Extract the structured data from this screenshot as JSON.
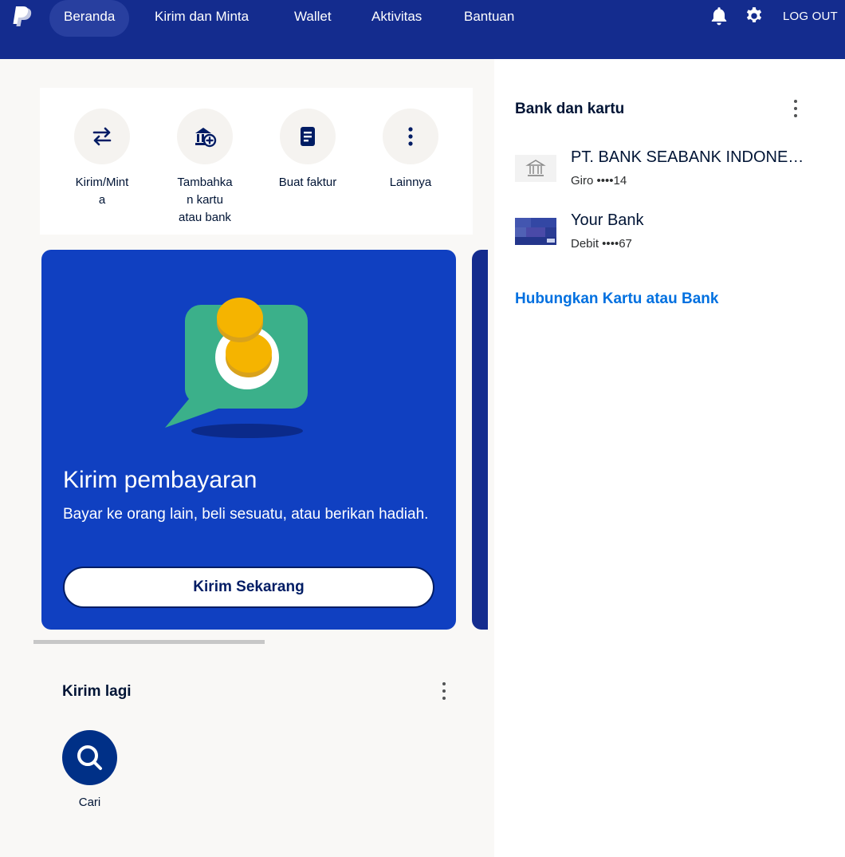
{
  "nav": {
    "logo_icon": "paypal-logo",
    "items": [
      {
        "label": "Beranda",
        "active": true
      },
      {
        "label": "Kirim dan Minta",
        "active": false
      },
      {
        "label": "Wallet",
        "active": false
      },
      {
        "label": "Aktivitas",
        "active": false
      },
      {
        "label": "Bantuan",
        "active": false
      }
    ],
    "icons": [
      "bell-icon",
      "gear-icon"
    ],
    "logout_label": "LOG OUT"
  },
  "quick_actions": [
    {
      "label": "Kirim/Mint\na",
      "icon": "transfer-arrows-icon"
    },
    {
      "label": "Tambahka\nn kartu\natau bank",
      "icon": "add-bank-icon"
    },
    {
      "label": "Buat faktur",
      "icon": "invoice-icon"
    },
    {
      "label": "Lainnya",
      "icon": "more-vertical-icon"
    }
  ],
  "promo": {
    "title": "Kirim pembayaran",
    "description": "Bayar ke orang lain, beli sesuatu, atau berikan hadiah.",
    "button_label": "Kirim Sekarang",
    "illustration": "chat-bubble-coins-illustration"
  },
  "send_again": {
    "title": "Kirim lagi",
    "search_label": "Cari"
  },
  "banks": {
    "title": "Bank dan kartu",
    "accounts": [
      {
        "name": "PT. BANK SEABANK INDONESIA",
        "detail": "Giro ••••14",
        "icon": "bank-building-icon"
      },
      {
        "name": "Your Bank",
        "detail": "Debit ••••67",
        "icon": "card-thumbnail"
      }
    ],
    "link_label": "Hubungkan Kartu atau Bank"
  },
  "colors": {
    "nav_bg": "#142c8e",
    "promo_bg": "#1040c1",
    "link": "#0070e0",
    "dark_blue": "#003087"
  }
}
